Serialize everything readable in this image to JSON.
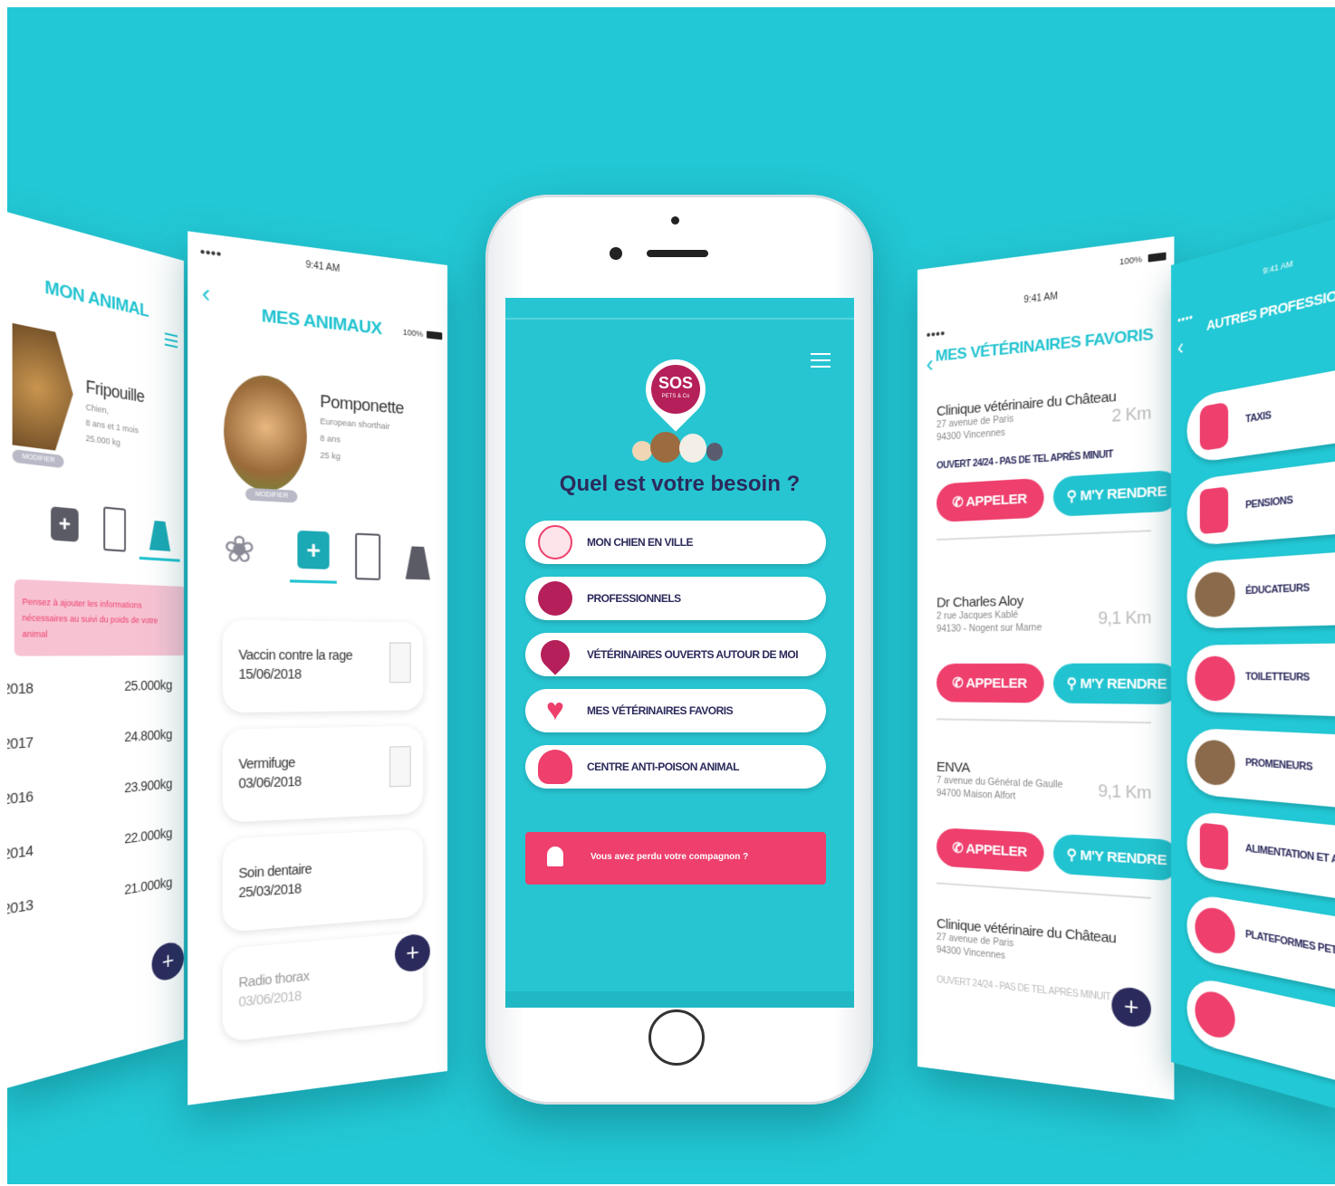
{
  "colors": {
    "background": "#22c8d5",
    "teal": "#22c3d0",
    "navy": "#2b2a5c",
    "pink": "#ee3f6d"
  },
  "left_far": {
    "title": "MON ANIMAL",
    "pet_name": "Fripouille",
    "pet_species": "Chien,",
    "pet_age": "8 ans et 1 mois",
    "pet_weight": "25.000 kg",
    "edit_label": "MODIFIER",
    "alert": "Pensez à ajouter les informations nécessaires au suivi du poids de votre animal",
    "weights": [
      {
        "year": "2018",
        "value": "25.000kg"
      },
      {
        "year": "2017",
        "value": "24.800kg"
      },
      {
        "year": "2016",
        "value": "23.900kg"
      },
      {
        "year": "2014",
        "value": "22.000kg"
      },
      {
        "year": "2013",
        "value": "21.000kg"
      }
    ],
    "fab": "+"
  },
  "left_near": {
    "time": "9:41 AM",
    "battery": "100%",
    "title": "MES ANIMAUX",
    "pet_name": "Pomponette",
    "pet_breed": "European shorthair",
    "pet_age": "8 ans",
    "pet_weight": "25 kg",
    "edit_label": "MODIFIER",
    "records": [
      {
        "title": "Vaccin contre la rage",
        "date": "15/06/2018"
      },
      {
        "title": "Vermifuge",
        "date": "03/06/2018"
      },
      {
        "title": "Soin dentaire",
        "date": "25/03/2018"
      },
      {
        "title": "Radio thorax",
        "date": "03/06/2018"
      }
    ],
    "fab": "+"
  },
  "center": {
    "logo_text": "SOS",
    "logo_sub": "PETS & Co",
    "headline": "Quel est votre besoin ?",
    "menu": [
      {
        "label": "MON CHIEN EN VILLE",
        "icon": "city-dog-icon"
      },
      {
        "label": "PROFESSIONNELS",
        "icon": "professional-icon"
      },
      {
        "label": "VÉTÉRINAIRES OUVERTS AUTOUR DE MOI",
        "icon": "vet-location-icon"
      },
      {
        "label": "MES VÉTÉRINAIRES FAVORIS",
        "icon": "heart-paw-icon"
      },
      {
        "label": "CENTRE ANTI-POISON ANIMAL",
        "icon": "skull-icon"
      }
    ],
    "lost_button": "Vous avez perdu votre compagnon ?"
  },
  "right_near": {
    "time": "9:41 AM",
    "battery": "100%",
    "title": "MES VÉTÉRINAIRES FAVORIS",
    "call_label": "APPELER",
    "go_label": "M'Y RENDRE",
    "vets": [
      {
        "name": "Clinique vétérinaire du Château",
        "addr1": "27 avenue de Paris",
        "addr2": "94300 Vincennes",
        "km": "2 Km",
        "note": "OUVERT 24/24 - PAS DE TEL APRÈS MINUIT"
      },
      {
        "name": "Dr Charles Aloy",
        "addr1": "2 rue Jacques Kablé",
        "addr2": "94130 - Nogent sur Marne",
        "km": "9,1 Km",
        "note": ""
      },
      {
        "name": "ENVA",
        "addr1": "7 avenue du Général de Gaulle",
        "addr2": "94700 Maison Alfort",
        "km": "9,1 Km",
        "note": ""
      },
      {
        "name": "Clinique vétérinaire du Château",
        "addr1": "27 avenue de Paris",
        "addr2": "94300 Vincennes",
        "km": "",
        "note": "OUVERT 24/24 - PAS DE TEL APRÈS MINUIT"
      }
    ],
    "fab": "+"
  },
  "right_far": {
    "time": "9:41 AM",
    "title": "AUTRES PROFESSIONNE",
    "items": [
      "TAXIS",
      "PENSIONS",
      "ÉDUCATEURS",
      "TOILETTEURS",
      "PROMENEURS",
      "ALIMENTATION ET ACCESS",
      "PLATEFORMES PETSITTERS"
    ]
  }
}
